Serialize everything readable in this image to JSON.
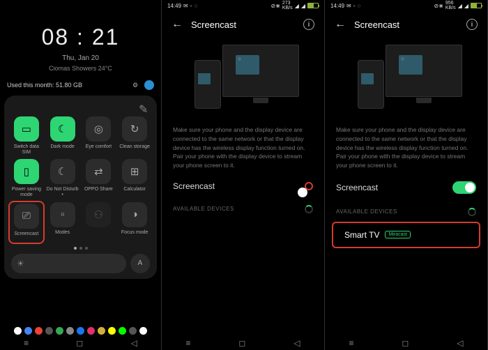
{
  "p1": {
    "time": "08 : 21",
    "date": "Thu, Jan 20",
    "weather": "Ciomas Showers 24°C",
    "usage": "Used this month: 51.80 GB",
    "tiles": [
      {
        "label": "Switch data SIM",
        "active": true,
        "icon": "▭"
      },
      {
        "label": "Dark mode",
        "active": true,
        "icon": "☾"
      },
      {
        "label": "Eye comfort",
        "active": false,
        "icon": "◎"
      },
      {
        "label": "Clean storage",
        "active": false,
        "icon": "↻"
      },
      {
        "label": "Power saving mode",
        "active": true,
        "icon": "▯"
      },
      {
        "label": "Do Not Disturb •",
        "active": false,
        "icon": "☾"
      },
      {
        "label": "OPPO Share",
        "active": false,
        "icon": "⇄"
      },
      {
        "label": "Calculator",
        "active": false,
        "icon": "⊞"
      },
      {
        "label": "Screencast",
        "active": false,
        "icon": "⎚",
        "hl": true
      },
      {
        "label": "Modes",
        "active": false,
        "icon": "▫"
      },
      {
        "label": "",
        "active": false,
        "icon": "⚇",
        "dim": true
      },
      {
        "label": "Focus mode",
        "active": false,
        "icon": "◑"
      }
    ],
    "auto": "A"
  },
  "sc": {
    "status_time": "14:49",
    "title": "Screencast",
    "desc": "Make sure your phone and the display device are connected to the same network or that the display device has the wireless display function turned on. Pair your phone with the display device to stream your phone screen to it.",
    "toggle_label": "Screencast",
    "section": "AVAILABLE DEVICES",
    "device": "Smart TV",
    "badge": "Miracast"
  }
}
